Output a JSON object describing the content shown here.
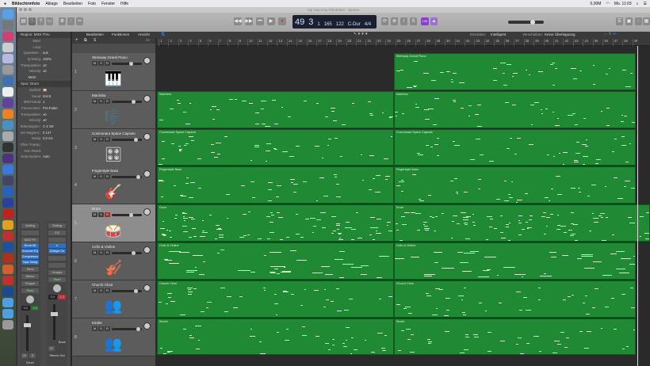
{
  "menubar": {
    "apple": "",
    "app": "Bildschirmfoto",
    "items": [
      "Ablage",
      "Bearbeiten",
      "Foto",
      "Fenster",
      "Hilfe"
    ],
    "status": [
      "0,00M",
      "Mo. 11:03"
    ]
  },
  "window": {
    "title": "Hip Hop Hop Pferdchen - Spuren"
  },
  "lcd": {
    "bar": "49",
    "beat": "3",
    "div": "1",
    "tick": "165",
    "tempo": "122",
    "key": "C-Dur",
    "signature": "4/4",
    "labels": [
      "Takt",
      "Beat",
      "Div",
      "Tick",
      "Tempo",
      "Tonart",
      "Takt"
    ]
  },
  "toolbar": {
    "count_in": "⁴/₄",
    "cpu": "128"
  },
  "controlbar": {
    "menus": [
      "Bearbeiten",
      "Funktionen",
      "Ansicht"
    ],
    "einrasten_label": "Einrasten:",
    "einrasten_value": "Intelligent",
    "verschieben_label": "Verschieben:",
    "verschieben_value": "Keine Überlappung"
  },
  "inspector": {
    "region_header": "Region: MIDI Thru",
    "region_rows": [
      {
        "k": "Mute:",
        "v": ""
      },
      {
        "k": "Loop:",
        "v": ""
      },
      {
        "k": "Quantisier...",
        "v": "aus"
      },
      {
        "k": "Q-Swing:",
        "v": "100%"
      },
      {
        "k": "Transposition:",
        "v": "±0"
      },
      {
        "k": "Velocity:",
        "v": "±0"
      }
    ],
    "mehr": "Mehr",
    "track_header": "Spur: Drum",
    "track_rows": [
      {
        "k": "Symbol:",
        "v": "🥁"
      },
      {
        "k": "Kanal:",
        "v": "Inst 8"
      },
      {
        "k": "MIDI-Kanal:",
        "v": "1"
      },
      {
        "k": "Freeze-Mod.:",
        "v": "Pre-Fader"
      },
      {
        "k": "Transposition:",
        "v": "±0"
      },
      {
        "k": "Velocity:",
        "v": "±0"
      },
      {
        "k": "Notenbegren.:",
        "v": "C-2  G8"
      },
      {
        "k": "Vel.-Begrenz.:",
        "v": "0   127"
      },
      {
        "k": "Delay:",
        "v": "0,0 ms"
      },
      {
        "k": "Ohne Transp.:",
        "v": ""
      },
      {
        "k": "Kein Reset:",
        "v": ""
      },
      {
        "k": "Notensystem:",
        "v": "Auto"
      }
    ]
  },
  "strips": [
    {
      "setting": "Setting",
      "eq": "",
      "midifx": "MIDI FX",
      "instrument": "Drum Kit",
      "fx": [
        "Channel EQ",
        "Compressor",
        "Tape Delay"
      ],
      "send": "Send",
      "output": "Stereo",
      "group": "Gruppe",
      "auto": "Read",
      "pan": "0,0",
      "level": "-0,6",
      "mute": "M",
      "solo": "S",
      "name": "Drum"
    },
    {
      "setting": "Setting",
      "eq": "EQ",
      "midifx": "",
      "instrument": "∞",
      "fx": [
        "iZotope Oz"
      ],
      "send": "",
      "output": "",
      "group": "Gruppe",
      "auto": "Read",
      "pan": "0,0",
      "level": "-1,0",
      "mute": "M",
      "solo": "",
      "bounce": "Bnce",
      "name": "Stereo Out"
    }
  ],
  "tracks": [
    {
      "num": "1",
      "name": "Steinway Grand Piano",
      "icon": "🎹",
      "regions": [
        "",
        "Steinway Grand Piano"
      ]
    },
    {
      "num": "2",
      "name": "Marimba",
      "icon": "🎼",
      "regions": [
        "Marimba",
        "Marimba"
      ]
    },
    {
      "num": "3",
      "name": "Cosmonaut Space Capsule",
      "icon": "🎛",
      "regions": [
        "Cosmonaut Space Capsule",
        "Cosmonaut Space Capsule"
      ]
    },
    {
      "num": "4",
      "name": "Fingerstyle Bass",
      "icon": "🎸",
      "regions": [
        "Fingerstyle Bass",
        "Fingerstyle Bass"
      ]
    },
    {
      "num": "5",
      "name": "Drum",
      "icon": "🥁",
      "regions": [
        "Drum",
        "Drum"
      ]
    },
    {
      "num": "6",
      "name": "Cello & Violine",
      "icon": "🎻",
      "regions": [
        "Cello & Violine",
        "Cello & Violine"
      ]
    },
    {
      "num": "7",
      "name": "Church Choir",
      "icon": "👥",
      "regions": [
        "Church Choir",
        "Church Choir"
      ]
    },
    {
      "num": "8",
      "name": "Kinder",
      "icon": "👥",
      "regions": [
        "Kinder",
        "Kinder"
      ]
    }
  ],
  "ruler": {
    "first_bar": 1,
    "last_bar": 49
  },
  "colors": {
    "region": "#1f8a33",
    "lcd": "#1a2030",
    "record": "#e0302a",
    "cpu": "#8a3fd0"
  }
}
